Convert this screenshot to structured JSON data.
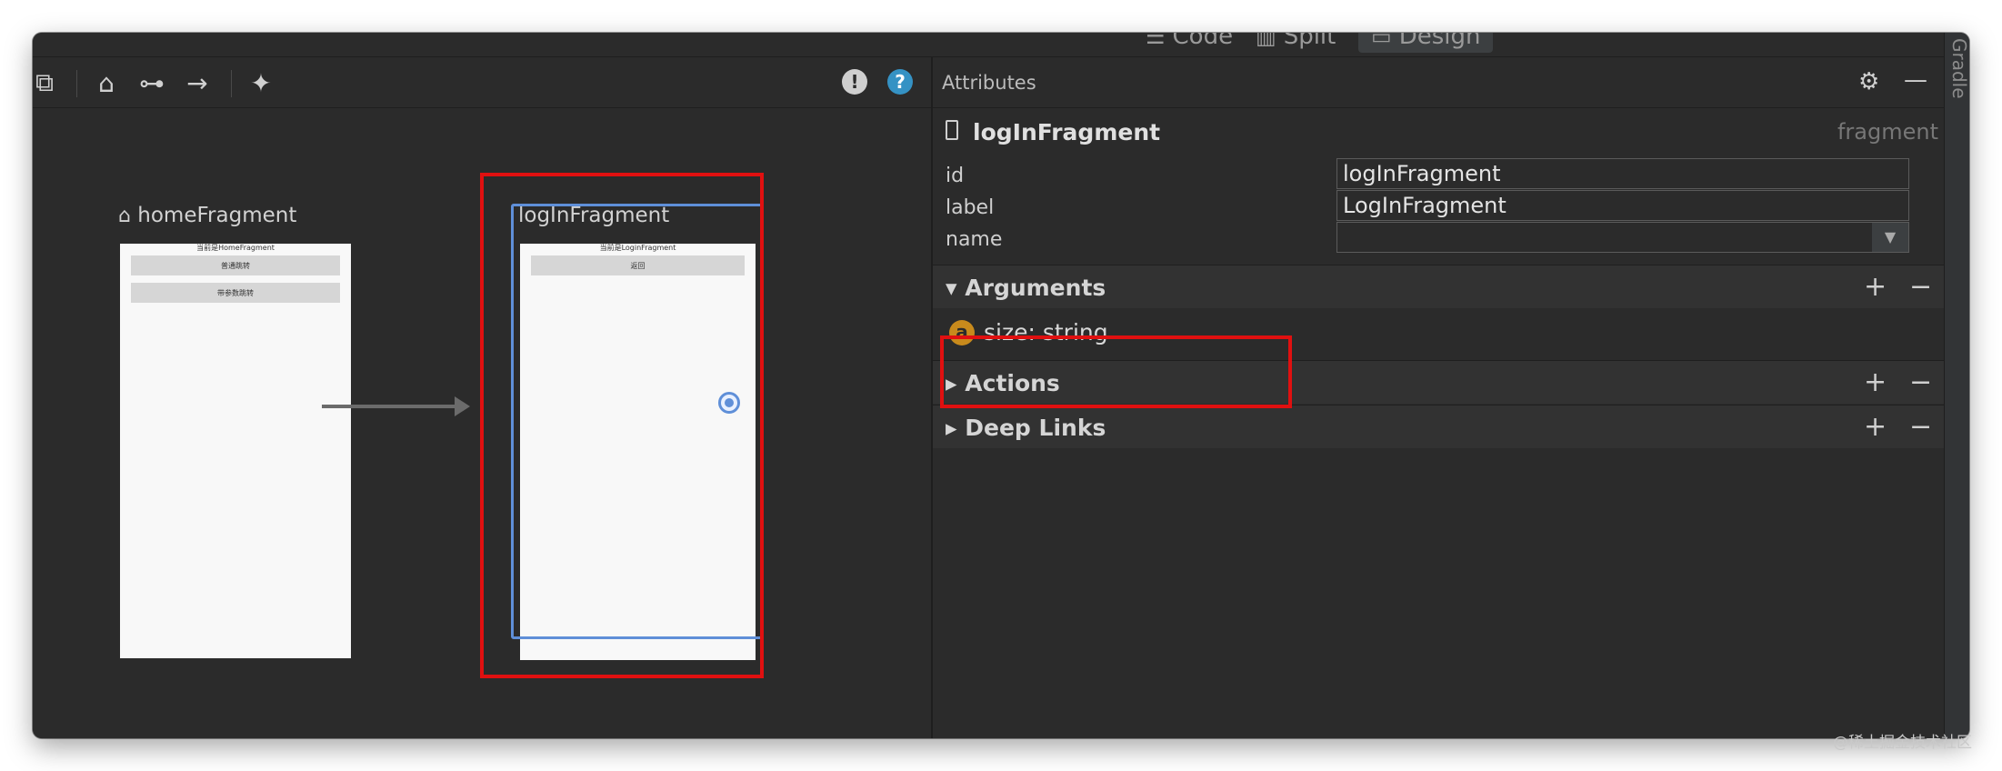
{
  "view_toggle": {
    "code": "Code",
    "split": "Split",
    "design": "Design",
    "side_label": "Gradle"
  },
  "toolbar": {
    "icons": [
      "device-frames-icon",
      "home-icon",
      "link-icon",
      "arrow-right-icon",
      "sparkle-icon",
      "warning-icon",
      "help-icon"
    ]
  },
  "graph": {
    "home_fragment": {
      "title": "homeFragment",
      "header": "当前是HomeFragment",
      "buttons": [
        "普通跳转",
        "带参数跳转"
      ]
    },
    "login_fragment": {
      "title": "logInFragment",
      "header": "当前是LoginFragment",
      "buttons": [
        "返回"
      ]
    }
  },
  "attributes": {
    "title": "Attributes",
    "selected": {
      "name": "logInFragment",
      "type": "fragment"
    },
    "fields": {
      "id_label": "id",
      "id_value": "logInFragment",
      "label_label": "label",
      "label_value": "LogInFragment",
      "name_label": "name",
      "name_value": ""
    },
    "sections": {
      "arguments": "Arguments",
      "actions": "Actions",
      "deep_links": "Deep Links"
    },
    "arguments": [
      {
        "badge": "a",
        "text": "size: string"
      }
    ]
  },
  "watermark": "@稀土掘金技术社区"
}
